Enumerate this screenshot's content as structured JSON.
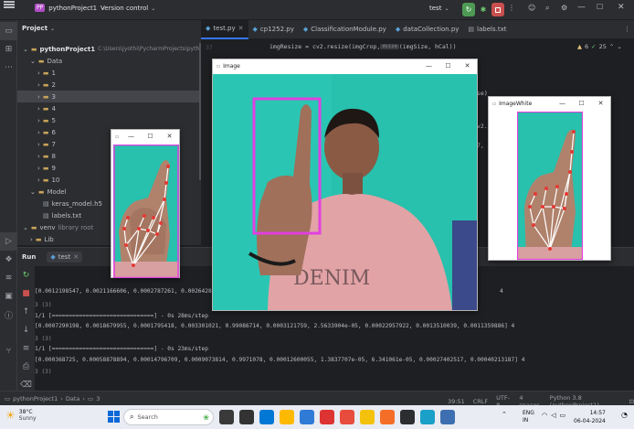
{
  "titlebar": {
    "project_badge": "PP",
    "project_name": "pythonProject1",
    "vcs": "Version control",
    "run_config": "test"
  },
  "project_panel": {
    "header": "Project",
    "root_name": "pythonProject1",
    "root_path": "C:\\Users\\jyothi\\PycharmProjects\\pythonProject",
    "data_folder": "Data",
    "data_items": [
      "1",
      "2",
      "3",
      "4",
      "5",
      "6",
      "7",
      "8",
      "9",
      "10"
    ],
    "model_folder": "Model",
    "model_files": [
      "keras_model.h5",
      "labels.txt"
    ],
    "venv": "venv",
    "venv_hint": "library root",
    "lib": "Lib"
  },
  "editor": {
    "tabs": [
      "test.py",
      "cp1252.py",
      "ClassificationModule.py",
      "dataCollection.py",
      "labels.txt"
    ],
    "line_numbers": [
      "37"
    ],
    "code_line_1": "imgResize = cv2.resize(imgCrop, ",
    "code_hint": "dsize",
    "code_line_1b": " (imgSize, hCal))",
    "warnings": "6",
    "checks": "25",
    "partial_right": [
      "se)",
      "v2.",
      "7,"
    ]
  },
  "image_window": {
    "title": "Image"
  },
  "image_white_window": {
    "title": "ImageWhite"
  },
  "hand_preview_window": {
    "title": ""
  },
  "run_panel": {
    "tab_run": "Run",
    "config": "test",
    "lines": [
      "[0.0012198547, 0.0021166606, 0.0002787261, 0.00264285,",
      "3 (3)",
      "1/1 [==============================] - 0s 28ms/step",
      "[0.0007290198, 0.0018679955, 0.0001795418, 0.003301021, 0.99086714, 0.0003121759, 2.5633904e-05, 0.00022957922, 0.0013510039, 0.0011359886] 4",
      "3 (3)",
      "1/1 [==============================] - 0s 23ms/step",
      "[0.000368725, 0.00058878894, 0.00014796709, 0.0009073814, 0.9971078, 0.00012600055, 1.3837707e-05, 6.341061e-05, 0.00027402517, 0.00040213187] 4",
      "3 (3)"
    ],
    "line1_suffix": "4"
  },
  "statusbar": {
    "breadcrumb": [
      "pythonProject1",
      "Data",
      "3"
    ],
    "position": "39:51",
    "line_sep": "CRLF",
    "encoding": "UTF-8",
    "indent": "4 spaces",
    "interpreter": "Python 3.8 (pythonProject1)"
  },
  "taskbar": {
    "weather_temp": "38°C",
    "weather_desc": "Sunny",
    "search_placeholder": "Search",
    "lang_1": "ENG",
    "lang_2": "IN",
    "time": "14:57",
    "date": "06-04-2024"
  },
  "colors": {
    "accent": "#3574f0",
    "selection": "#43454a",
    "box_magenta": "#e040e0",
    "teal_bg": "#27c1ad",
    "landmark_red": "#e53935"
  }
}
